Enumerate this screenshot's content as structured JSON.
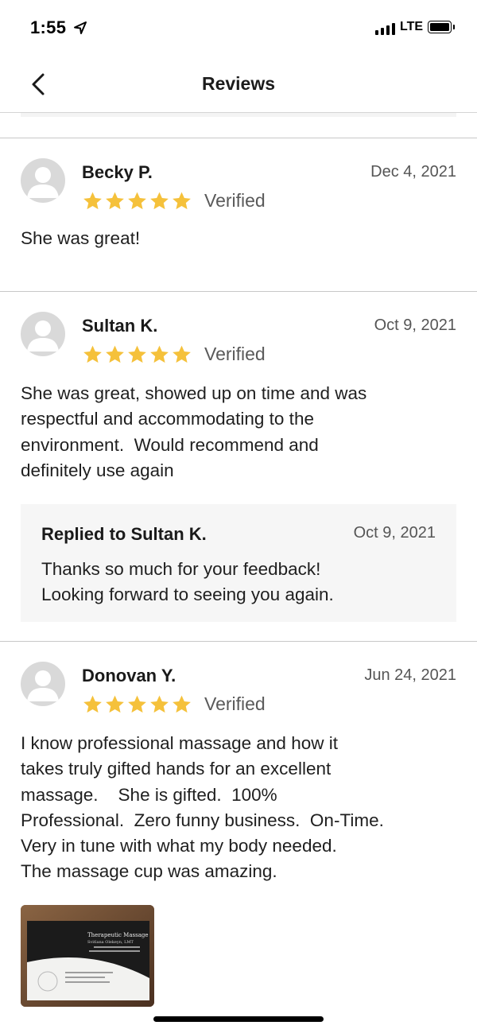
{
  "status_bar": {
    "time": "1:55",
    "network": "LTE",
    "signal_bars": 4,
    "battery_level": 1.0
  },
  "nav": {
    "title": "Reviews"
  },
  "colors": {
    "star": "#F5C13B",
    "divider": "#C8C8C8",
    "reply_bg": "#F6F6F6"
  },
  "reviews": [
    {
      "name": "Becky P.",
      "date": "Dec 4, 2021",
      "rating": 5,
      "verified_label": "Verified",
      "text": "She was great!"
    },
    {
      "name": "Sultan K.",
      "date": "Oct 9, 2021",
      "rating": 5,
      "verified_label": "Verified",
      "text": "She was great, showed up on time and was\nrespectful and accommodating to the\nenvironment.  Would recommend and\ndefinitely use again",
      "reply": {
        "title": "Replied to Sultan K.",
        "date": "Oct 9, 2021",
        "text": "Thanks so much for your feedback!\nLooking forward to seeing you again."
      }
    },
    {
      "name": "Donovan Y.",
      "date": "Jun 24, 2021",
      "rating": 5,
      "verified_label": "Verified",
      "text": "I know professional massage and how it\ntakes truly gifted hands for an excellent\nmassage.    She is gifted.  100%\nProfessional.  Zero funny business.  On-Time.\nVery in tune with what my body needed.\nThe massage cup was amazing.",
      "photo": {
        "card_title": "Therapeutic Massage",
        "card_name": "Svitlana Olekeyn, LMT"
      }
    }
  ]
}
